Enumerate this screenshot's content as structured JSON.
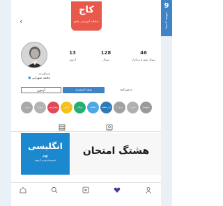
{
  "corner_tag": {
    "number": "9",
    "subtitle": "رشته‌ی مطالعه"
  },
  "header": {
    "logo_text": "کاج",
    "logo_tagline": "سامانه آموزشی جامع"
  },
  "profile": {
    "stats": [
      {
        "value": "46",
        "label": "سوال مهم و پرتکرار"
      },
      {
        "value": "128",
        "label": "سوال"
      },
      {
        "value": "13",
        "label": "آزمون"
      }
    ],
    "role": "پدیدآورنده",
    "name": "محمد سهرابی",
    "avatar": "author-portrait"
  },
  "tabs": [
    {
      "label": "آزمون"
    },
    {
      "label": "ورق استوری",
      "active": true
    },
    {
      "label": "درس‌نامه"
    }
  ],
  "chips": [
    {
      "label": "درس ۱",
      "color": "#a9a9a9"
    },
    {
      "label": "درس ۲",
      "color": "#b3b3b3"
    },
    {
      "label": "پیش‌آزمون",
      "color": "#e1495b"
    },
    {
      "label": "گرامر",
      "color": "#f4c21b"
    },
    {
      "label": "واژگان",
      "color": "#26ad72"
    },
    {
      "label": "مکالمه",
      "color": "#4ea8e6"
    },
    {
      "label": "درک مطلب",
      "color": "#2e7ab8"
    },
    {
      "label": "درس ۳",
      "color": "#a0a0a0"
    },
    {
      "label": "درس ۴",
      "color": "#b0b0b0"
    },
    {
      "label": "جمع‌بندی",
      "color": "#9a9a9a"
    }
  ],
  "posts": [
    {
      "title": "انگلیسی",
      "grade": "نهم",
      "note": "درس‌به‌درس و آزمون"
    },
    {
      "title": "هشتگ امتحان"
    }
  ],
  "colors": {
    "accent": "#3f84c6",
    "logo_bg": "#e8584b",
    "story_blue": "#1b88cf"
  }
}
